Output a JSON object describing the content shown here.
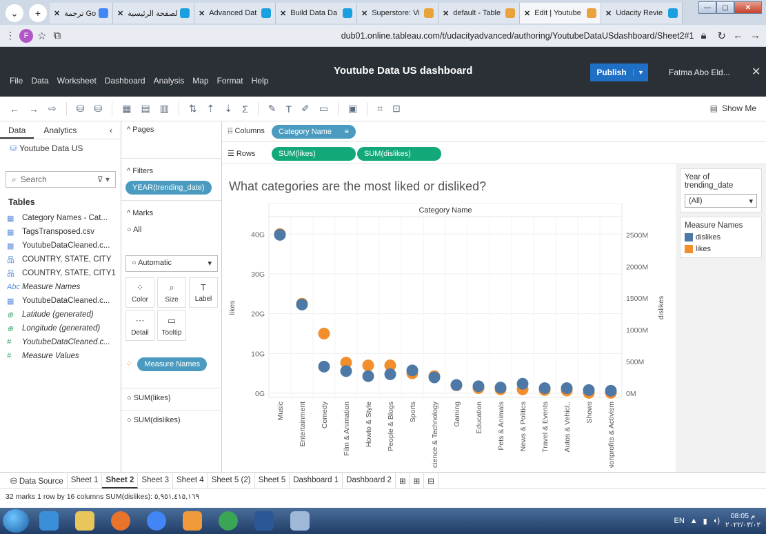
{
  "browser": {
    "tabs": [
      {
        "label": "ترجمة Google",
        "color": "#4285f4"
      },
      {
        "label": "الصفحة الرئيسية -",
        "color": "#1aa0e0"
      },
      {
        "label": "Advanced Dat",
        "color": "#1aa0e0"
      },
      {
        "label": "Build Data Da",
        "color": "#1aa0e0"
      },
      {
        "label": "Superstore: Vi",
        "color": "#e8a33c"
      },
      {
        "label": "default - Table",
        "color": "#e8a33c"
      },
      {
        "label": "Edit | Youtube",
        "color": "#e8a33c"
      },
      {
        "label": "Udacity Revie",
        "color": "#1aa0e0"
      }
    ],
    "url": "dub01.online.tableau.com/t/udacityadvanced/authoring/YoutubeDataUSdashboard/Sheet2#1",
    "profile_initial": "F"
  },
  "tableau": {
    "menu": [
      "File",
      "Data",
      "Worksheet",
      "Dashboard",
      "Analysis",
      "Map",
      "Format",
      "Help"
    ],
    "title": "Youtube Data US dashboard",
    "publish_label": "Publish",
    "user": "Fatma Abo Eld...",
    "show_me": "Show Me"
  },
  "datapane": {
    "tab_data": "Data",
    "tab_analytics": "Analytics",
    "source": "Youtube Data US",
    "search_placeholder": "Search",
    "tables_header": "Tables",
    "fields": [
      {
        "label": "Category Names - Cat...",
        "icon": "table-icon",
        "italic": false
      },
      {
        "label": "TagsTransposed.csv",
        "icon": "table-icon",
        "italic": false
      },
      {
        "label": "YoutubeDataCleaned.c...",
        "icon": "table-icon",
        "italic": false
      },
      {
        "label": "COUNTRY, STATE, CITY",
        "icon": "hierarchy-icon",
        "italic": false
      },
      {
        "label": "COUNTRY, STATE, CITY1",
        "icon": "hierarchy-icon",
        "italic": false
      },
      {
        "label": "Measure Names",
        "icon": "abc-icon",
        "italic": true
      },
      {
        "label": "YoutubeDataCleaned.c...",
        "icon": "table-icon",
        "italic": false
      },
      {
        "label": "Latitude (generated)",
        "icon": "globe-icon",
        "italic": true
      },
      {
        "label": "Longitude (generated)",
        "icon": "globe-icon",
        "italic": true
      },
      {
        "label": "YoutubeDataCleaned.c...",
        "icon": "hash-icon",
        "italic": true
      },
      {
        "label": "Measure Values",
        "icon": "hash-icon",
        "italic": true
      }
    ]
  },
  "cards": {
    "pages": "Pages",
    "filters": "Filters",
    "filter_pill": "YEAR(trending_date)",
    "marks": "Marks",
    "marks_all": "All",
    "marks_type": "Automatic",
    "buttons": [
      "Color",
      "Size",
      "Label",
      "Detail",
      "Tooltip"
    ],
    "color_pill": "Measure Names",
    "sum_likes": "SUM(likes)",
    "sum_dislikes": "SUM(dislikes)"
  },
  "shelves": {
    "columns_label": "Columns",
    "columns_pill": "Category Name",
    "rows_label": "Rows",
    "rows_pills": [
      "SUM(likes)",
      "SUM(dislikes)"
    ]
  },
  "rightpane": {
    "filter_title": "Year of trending_date",
    "filter_value": "(All)",
    "legend_title": "Measure Names",
    "legend": [
      {
        "label": "dislikes",
        "color": "#4e79a7"
      },
      {
        "label": "likes",
        "color": "#f28e2b"
      }
    ]
  },
  "chart_data": {
    "type": "scatter",
    "title": "What categories are the most liked or disliked?",
    "header": "Category Name",
    "categories": [
      "Music",
      "Entertainment",
      "Comedy",
      "Film & Animation",
      "Howto & Style",
      "People & Blogs",
      "Sports",
      "Science & Technology",
      "Gaming",
      "Education",
      "Pets & Animals",
      "News & Politics",
      "Travel & Events",
      "Autos & Vehicl..",
      "Shows",
      "Nonprofits & Activism"
    ],
    "left_axis": {
      "label": "likes",
      "ticks": [
        "0G",
        "10G",
        "20G",
        "30G",
        "40G"
      ],
      "range": [
        0,
        43
      ]
    },
    "right_axis": {
      "label": "dislikes",
      "ticks": [
        "0M",
        "500M",
        "1000M",
        "1500M",
        "2000M",
        "2500M"
      ],
      "range": [
        0,
        2700
      ]
    },
    "series": [
      {
        "name": "likes",
        "color": "#f28e2b",
        "axis": "left",
        "values": [
          40,
          22.5,
          15,
          7.7,
          7,
          7,
          5,
          4.3,
          2,
          1.3,
          1,
          1,
          0.8,
          0.7,
          0.1,
          0.1
        ]
      },
      {
        "name": "dislikes",
        "color": "#4e79a7",
        "axis": "right",
        "values": [
          2500,
          1400,
          420,
          350,
          270,
          300,
          360,
          250,
          130,
          110,
          90,
          150,
          80,
          80,
          50,
          40
        ]
      }
    ],
    "grid": true
  },
  "sheettabs": {
    "datasource": "Data Source",
    "sheets": [
      "Sheet 1",
      "Sheet 2",
      "Sheet 3",
      "Sheet 4",
      "Sheet 5 (2)",
      "Sheet 5",
      "Dashboard 1",
      "Dashboard 2"
    ],
    "active": "Sheet 2"
  },
  "statusbar": "32 marks   1 row by 16 columns   SUM(dislikes): ٥,٩٥١,٤١٥,١٦٩",
  "tray": {
    "lang": "EN",
    "time": "08:05 م",
    "date": "٢٠٢٢/٠٣/٠٢"
  }
}
